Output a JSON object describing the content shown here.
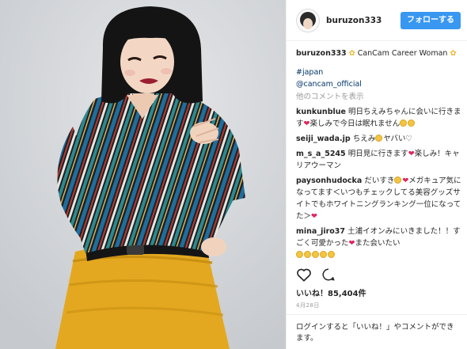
{
  "post": {
    "username": "buruzon333",
    "follow_label": "フォローする",
    "caption_user": "buruzon333",
    "caption_text": "CanCam Career Woman",
    "hashtag": "#japan",
    "mention": "@cancam_official",
    "more_comments_label": "他のコメントを表示",
    "comments": [
      {
        "user": "kunkunblue",
        "text": "明日ちえみちゃんに会いに行きます",
        "tail": "楽しみで今日は眠れません"
      },
      {
        "user": "seiji_wada.jp",
        "text": "ちえみ",
        "tail": "ヤバい♡"
      },
      {
        "user": "m_s_a_5245",
        "text": "明日見に行きます",
        "tail": "楽しみ！キャリアウーマン"
      },
      {
        "user": "paysonhudocka",
        "text": "だいすき",
        "tail": "メガキュア気になってます＜いつもチェックしてる美容グッズサイトでもホワイトニングランキング一位になってた＞"
      },
      {
        "user": "mina_jiro37",
        "text": "土浦イオンみにいきました！！すごく可愛かった",
        "tail": "また会いたい"
      }
    ],
    "likes_label": "いいね！85,404件",
    "date_label": "4月28日",
    "login_link": "ログイン",
    "login_text": "すると「いいね！」やコメントができます。"
  },
  "colors": {
    "follow_button": "#3897f0",
    "heart": "#e0245e",
    "star": "#f0b429"
  },
  "icons": [
    "heart-outline-icon",
    "comment-icon",
    "star-icon"
  ]
}
